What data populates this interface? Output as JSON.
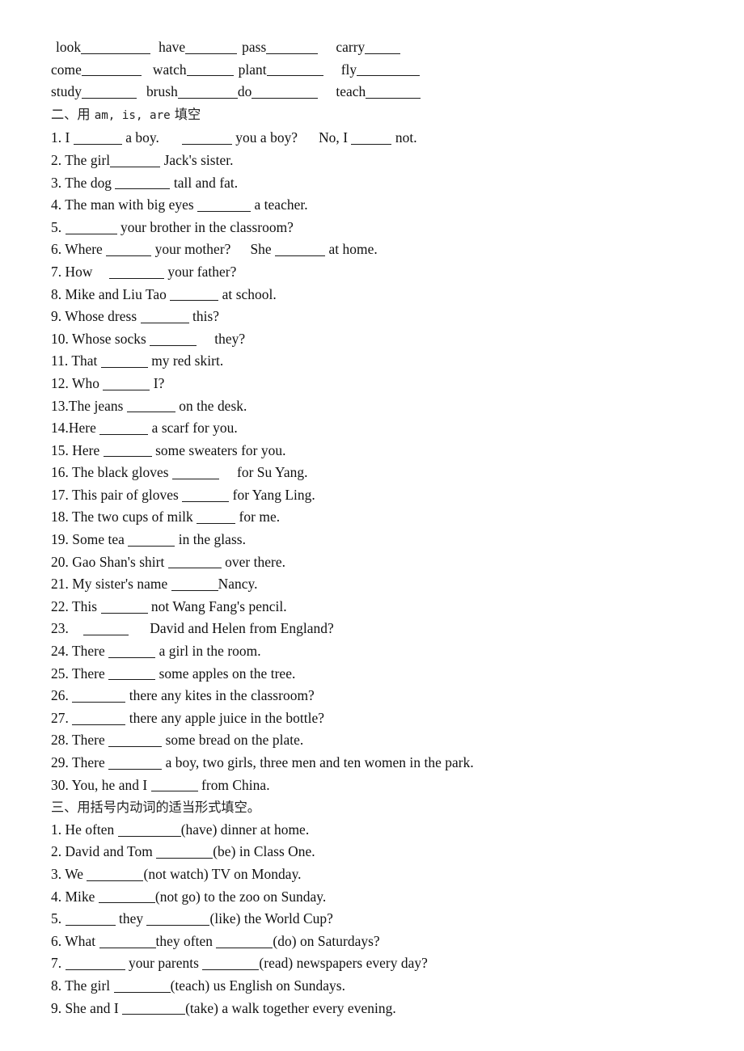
{
  "document": {
    "type": "worksheet",
    "language": "English exercises with Chinese instructions",
    "background_color": "#ffffff",
    "text_color": "#111111"
  },
  "verb_table": {
    "rows": [
      [
        {
          "word": "look",
          "gap_before": 6,
          "blank": 86
        },
        {
          "word": "have",
          "gap_before": 10,
          "blank": 64
        },
        {
          "word": "pass",
          "gap_before": 6,
          "blank": 64
        },
        {
          "word": "carry",
          "gap_before": 22,
          "blank": 44
        }
      ],
      [
        {
          "word": "come",
          "gap_before": 0,
          "blank": 74
        },
        {
          "word": "watch",
          "gap_before": 14,
          "blank": 58
        },
        {
          "word": "plant",
          "gap_before": 6,
          "blank": 70
        },
        {
          "word": "fly",
          "gap_before": 22,
          "blank": 78
        }
      ],
      [
        {
          "word": "study",
          "gap_before": 0,
          "blank": 68
        },
        {
          "word": "brush",
          "gap_before": 12,
          "blank": 74
        },
        {
          "word": "do",
          "gap_before": 0,
          "blank": 82
        },
        {
          "word": "teach",
          "gap_before": 22,
          "blank": 68
        }
      ]
    ]
  },
  "section_two": {
    "heading": "二、用 am, is, are 填空",
    "heading_prefix": "二、用 ",
    "heading_mono": "am, is, are",
    "heading_suffix": " 填空",
    "items": [
      {
        "num": "1. ",
        "parts": [
          "I ",
          {
            "b": 60
          },
          " a boy.",
          {
            "s": 28
          },
          {
            "b": 62
          },
          " you a boy?",
          {
            "s": 26
          },
          "No, I ",
          {
            "b": 50
          },
          " not."
        ]
      },
      {
        "num": "2. ",
        "parts": [
          "The girl",
          {
            "b": 62
          },
          " Jack's sister."
        ]
      },
      {
        "num": "3. ",
        "parts": [
          "The dog ",
          {
            "b": 68
          },
          " tall and fat."
        ]
      },
      {
        "num": "4. ",
        "parts": [
          "The man with big eyes ",
          {
            "b": 66
          },
          " a teacher."
        ]
      },
      {
        "num": "5. ",
        "parts": [
          {
            "b": 64
          },
          " your brother in the classroom?"
        ]
      },
      {
        "num": "6. ",
        "parts": [
          "Where ",
          {
            "b": 56
          },
          " your mother?",
          {
            "s": 24
          },
          "She ",
          {
            "b": 62
          },
          " at home."
        ]
      },
      {
        "num": "7. ",
        "parts": [
          "How ",
          {
            "s": 16
          },
          {
            "b": 68
          },
          " your father?"
        ]
      },
      {
        "num": "8. ",
        "parts": [
          "Mike and Liu Tao ",
          {
            "b": 60
          },
          " at school."
        ]
      },
      {
        "num": "9. ",
        "parts": [
          "Whose dress ",
          {
            "b": 60
          },
          " this?"
        ]
      },
      {
        "num": "10. ",
        "parts": [
          "Whose socks ",
          {
            "b": 58
          },
          {
            "s": 22
          },
          "they?"
        ]
      },
      {
        "num": "11. ",
        "parts": [
          "That ",
          {
            "b": 58
          },
          " my red skirt."
        ]
      },
      {
        "num": "12. ",
        "parts": [
          "Who ",
          {
            "b": 58
          },
          " I?"
        ]
      },
      {
        "num": "13.",
        "parts": [
          "The jeans ",
          {
            "b": 60
          },
          " on the desk."
        ]
      },
      {
        "num": "14.",
        "parts": [
          "Here ",
          {
            "b": 60
          },
          " a scarf for you."
        ]
      },
      {
        "num": "15. ",
        "parts": [
          "Here ",
          {
            "b": 60
          },
          " some sweaters for you."
        ]
      },
      {
        "num": "16. ",
        "parts": [
          "The black gloves ",
          {
            "b": 58
          },
          {
            "s": 22
          },
          "for Su Yang."
        ]
      },
      {
        "num": "17. ",
        "parts": [
          "This pair of gloves ",
          {
            "b": 58
          },
          " for Yang Ling."
        ]
      },
      {
        "num": "18. ",
        "parts": [
          "The two cups of milk ",
          {
            "b": 48
          },
          " for me."
        ]
      },
      {
        "num": "19. ",
        "parts": [
          "Some tea ",
          {
            "b": 58
          },
          " in the glass."
        ]
      },
      {
        "num": "20. ",
        "parts": [
          "Gao Shan's shirt ",
          {
            "b": 66
          },
          " over there."
        ]
      },
      {
        "num": "21. ",
        "parts": [
          "My sister's name ",
          {
            "b": 58
          },
          "Nancy."
        ]
      },
      {
        "num": "22. ",
        "parts": [
          "This ",
          {
            "b": 58
          },
          " not Wang Fang's pencil."
        ]
      },
      {
        "num": "23. ",
        "parts": [
          {
            "s": 14
          },
          {
            "b": 56
          },
          {
            "s": 26
          },
          "David and Helen from England?"
        ]
      },
      {
        "num": "24. ",
        "parts": [
          "There ",
          {
            "b": 58
          },
          " a girl in the room."
        ]
      },
      {
        "num": "25. ",
        "parts": [
          "There ",
          {
            "b": 58
          },
          " some apples on the tree."
        ]
      },
      {
        "num": "26. ",
        "parts": [
          {
            "b": 66
          },
          " there any kites in the classroom?"
        ]
      },
      {
        "num": "27. ",
        "parts": [
          {
            "b": 66
          },
          " there any apple juice in the bottle?"
        ]
      },
      {
        "num": "28. ",
        "parts": [
          "There ",
          {
            "b": 66
          },
          " some bread on the plate."
        ]
      },
      {
        "num": "29. ",
        "parts": [
          "There ",
          {
            "b": 66
          },
          " a boy, two girls, three men and ten women in the park."
        ]
      },
      {
        "num": "30. ",
        "parts": [
          "You, he and I ",
          {
            "b": 58
          },
          " from China."
        ]
      }
    ]
  },
  "section_three": {
    "heading": "三、用括号内动词的适当形式填空。",
    "items": [
      {
        "num": "1. ",
        "parts": [
          "He often ",
          {
            "b": 78
          },
          "(have) dinner at home."
        ]
      },
      {
        "num": "2. ",
        "parts": [
          "David and Tom ",
          {
            "b": 70
          },
          "(be) in Class One."
        ]
      },
      {
        "num": "3. ",
        "parts": [
          "We ",
          {
            "b": 70
          },
          "(not watch) TV on Monday."
        ]
      },
      {
        "num": "4. ",
        "parts": [
          "Mike ",
          {
            "b": 70
          },
          "(not go) to the zoo on Sunday."
        ]
      },
      {
        "num": "5. ",
        "parts": [
          {
            "b": 62
          },
          " they ",
          {
            "b": 78
          },
          "(like) the World Cup?"
        ]
      },
      {
        "num": "6. ",
        "parts": [
          "What ",
          {
            "b": 70
          },
          "they often ",
          {
            "b": 70
          },
          "(do) on Saturdays?"
        ]
      },
      {
        "num": "7. ",
        "parts": [
          {
            "b": 74
          },
          " your parents ",
          {
            "b": 70
          },
          "(read) newspapers every day?"
        ]
      },
      {
        "num": "8. ",
        "parts": [
          "The girl ",
          {
            "b": 70
          },
          "(teach) us English on Sundays."
        ]
      },
      {
        "num": "9. ",
        "parts": [
          "She and I ",
          {
            "b": 78
          },
          "(take) a walk together every evening."
        ]
      }
    ]
  }
}
